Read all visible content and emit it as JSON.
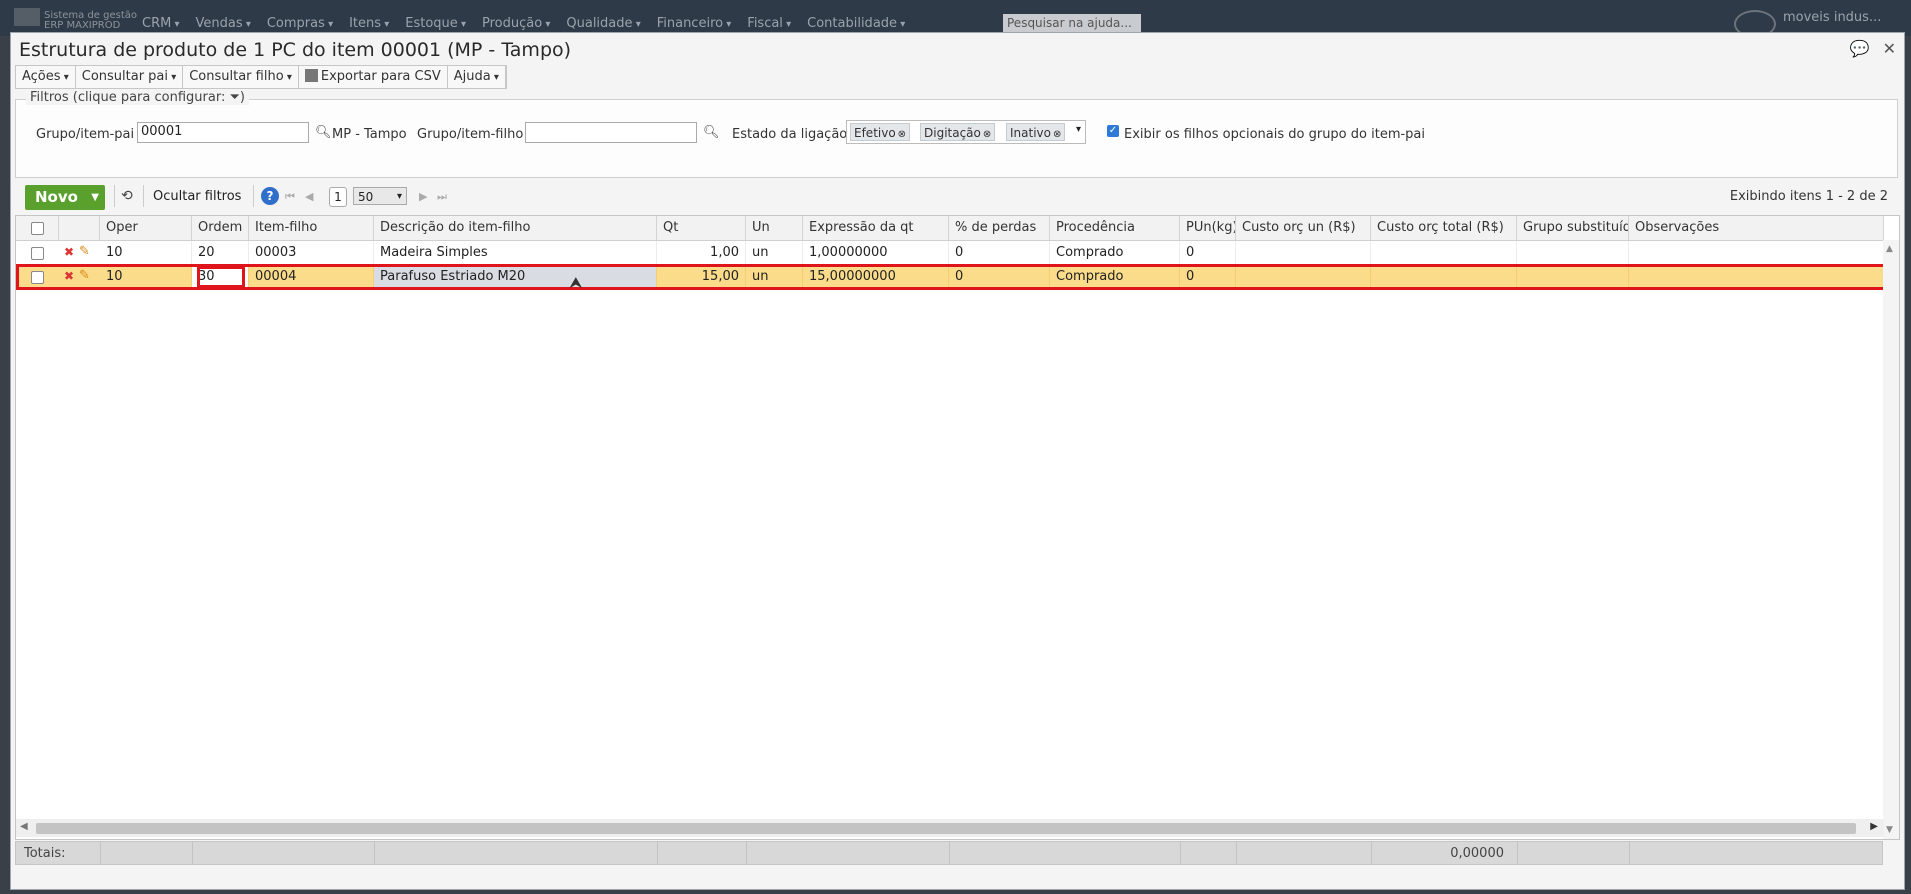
{
  "appbar": {
    "brand_line1": "Sistema de gestão",
    "brand_line2": "ERP MAXIPROD",
    "menus": [
      "CRM",
      "Vendas",
      "Compras",
      "Itens",
      "Estoque",
      "Produção",
      "Qualidade",
      "Financeiro",
      "Fiscal",
      "Contabilidade"
    ],
    "search_placeholder": "Pesquisar na ajuda...",
    "user": "moveis indus..."
  },
  "dialog": {
    "title": "Estrutura de produto de 1 PC do item 00001 (MP - Tampo)"
  },
  "menubar": {
    "acoes": "Ações",
    "consultar_pai": "Consultar pai",
    "consultar_filho": "Consultar filho",
    "exportar_csv": "Exportar para CSV",
    "ajuda": "Ajuda"
  },
  "filters": {
    "legend": "Filtros (clique para configurar:",
    "grupo_pai_label": "Grupo/item-pai",
    "grupo_pai_value": "00001",
    "grupo_pai_desc": "MP - Tampo",
    "grupo_filho_label": "Grupo/item-filho",
    "grupo_filho_value": "",
    "estado_label": "Estado da ligação",
    "estado_tags": [
      "Efetivo",
      "Digitação",
      "Inativo"
    ],
    "checkbox_label": "Exibir os filhos opcionais do grupo do item-pai",
    "checkbox_checked": true
  },
  "toolbar": {
    "novo_label": "Novo",
    "ocultar_filtros": "Ocultar filtros",
    "page": "1",
    "page_size": "50",
    "showing": "Exibindo itens 1 - 2 de 2"
  },
  "grid": {
    "columns": [
      "Oper",
      "Ordem",
      "Item-filho",
      "Descrição do item-filho",
      "Qt",
      "Un",
      "Expressão da qt",
      "% de perdas",
      "Procedência",
      "PUn(kg)",
      "Custo orç un (R$)",
      "Custo orç total (R$)",
      "Grupo substituído",
      "Observações"
    ],
    "rows": [
      {
        "oper": "10",
        "ordem": "20",
        "item": "00003",
        "desc": "Madeira Simples",
        "qt": "1,00",
        "un": "un",
        "expr": "1,00000000",
        "perdas": "0",
        "proc": "Comprado",
        "pun": "0",
        "custo_un": "",
        "custo_total": "",
        "grupo_subst": "",
        "obs": ""
      },
      {
        "oper": "10",
        "ordem": "30",
        "item": "00004",
        "desc": "Parafuso Estriado M20",
        "qt": "15,00",
        "un": "un",
        "expr": "15,00000000",
        "perdas": "0",
        "proc": "Comprado",
        "pun": "0",
        "custo_un": "",
        "custo_total": "",
        "grupo_subst": "",
        "obs": ""
      }
    ]
  },
  "totals": {
    "label": "Totais:",
    "custo_total": "0,00000"
  }
}
